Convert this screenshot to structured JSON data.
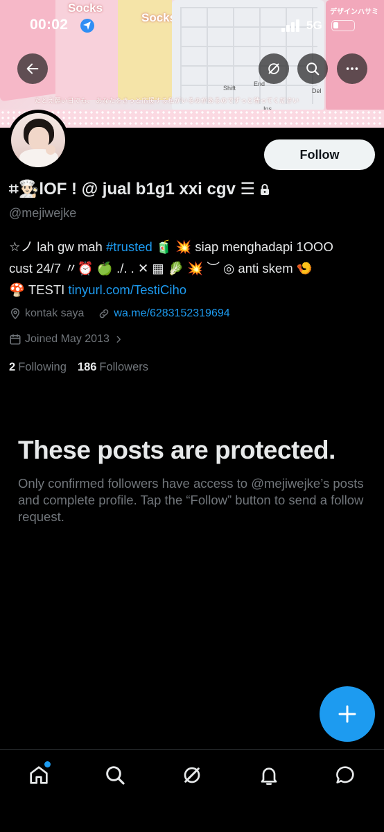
{
  "status_bar": {
    "time": "00:02",
    "network": "5G"
  },
  "banner": {
    "japanese_strip": "たとえ願い日でも、 あなたをきっと応援する私がいるのがあるのでずっと待ってください",
    "sticker_text_1": "Socks",
    "sticker_text_2": "Socks",
    "key_shift": "Shift",
    "key_end": "End",
    "key_del": "Del",
    "key_ins": "Ins",
    "pink_label": "デザインハサミ"
  },
  "header_actions": {
    "back": "back",
    "grok": "grok",
    "search": "search",
    "more": "more"
  },
  "profile": {
    "display_name": "⌗👨🏻‍🍳lOF ! @ jual b1g1 xxi cgv ☰",
    "handle": "@mejiwejke",
    "follow_label": "Follow",
    "bio_line1_a": "☆ノ lah gw mah ",
    "bio_hashtag": "#trusted",
    "bio_line1_b": " 🧃  💥  siap menghadapi 1OOO",
    "bio_line2": "cust 24/7 〃⏰ 🍏 ./. . ✕ ▦ 🥬 💥 ︶ ◎ anti skem 🍤",
    "bio_line3_a": "🍄 TESTI ",
    "bio_link": "tinyurl.com/TestiCiho",
    "location": "kontak saya",
    "website": "wa.me/6283152319694",
    "joined": "Joined May 2013",
    "following_count": "2",
    "following_label": "Following",
    "followers_count": "186",
    "followers_label": "Followers"
  },
  "protected": {
    "title": "These posts are protected.",
    "body": "Only confirmed followers have access to @mejiwejke’s posts and complete profile. Tap the “Follow” button to send a follow request."
  },
  "colors": {
    "accent": "#1d9bf0",
    "background": "#000000",
    "secondary_text": "#71767b"
  },
  "tabs": [
    "home-icon",
    "search-icon",
    "grok-icon",
    "notifications-icon",
    "messages-icon"
  ]
}
